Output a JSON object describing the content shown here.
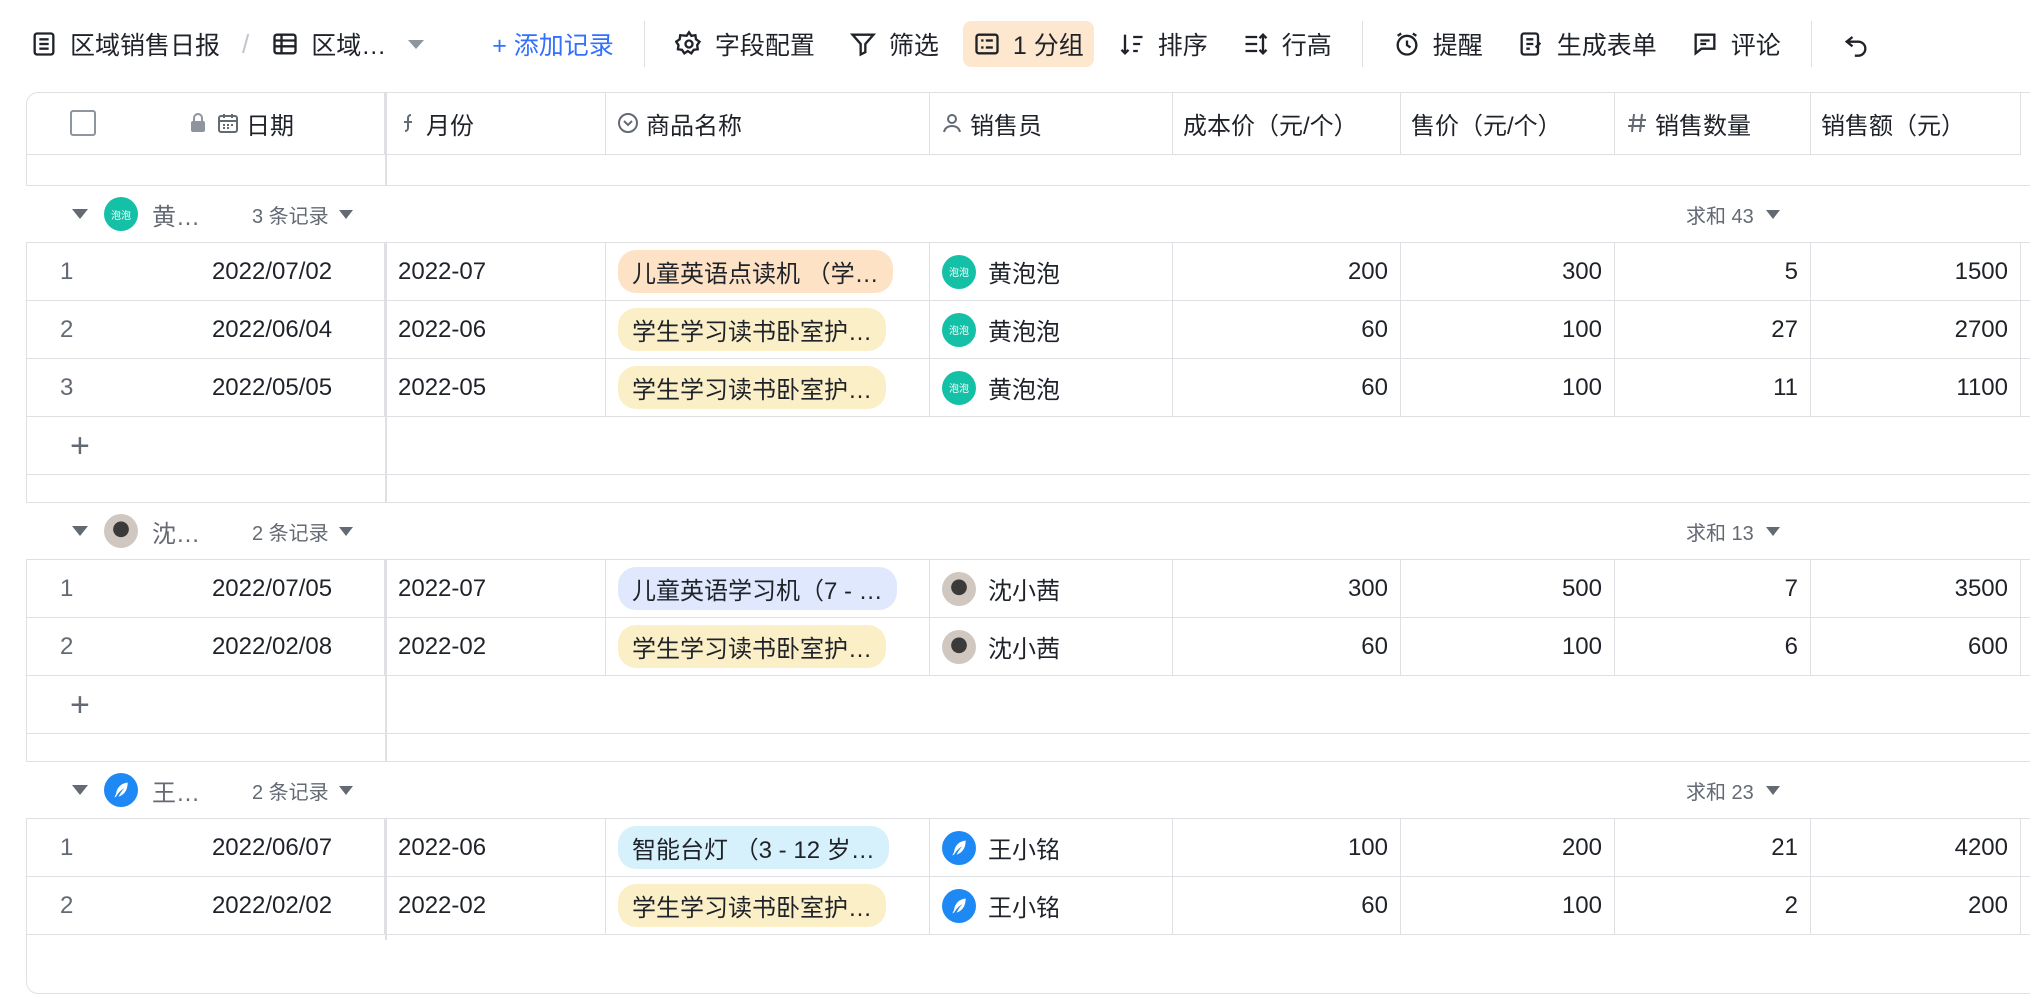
{
  "toolbar": {
    "table_name": "区域销售日报",
    "view_name": "区域…",
    "add_record": "+ 添加记录",
    "field_config": "字段配置",
    "filter": "筛选",
    "group": "1 分组",
    "sort": "排序",
    "row_height": "行高",
    "reminder": "提醒",
    "form": "生成表单",
    "comment": "评论"
  },
  "columns": {
    "date": "日期",
    "month": "月份",
    "product": "商品名称",
    "seller": "销售员",
    "cost": "成本价（元/个）",
    "price": "售价（元/个）",
    "qty": "销售数量",
    "revenue": "销售额（元）"
  },
  "colors": {
    "accent": "#3370ff",
    "group_active": "#fde7cf",
    "tag_orange": "#fde2c6",
    "tag_yellow": "#fbefc8",
    "tag_blue": "#dfe8fd",
    "tag_cyan": "#d6f1fb"
  },
  "groups": [
    {
      "name": "黄…",
      "count": "3 条记录",
      "sum": "求和 43",
      "avatar_text": "泡泡",
      "rows": [
        {
          "idx": "1",
          "date": "2022/07/02",
          "month": "2022-07",
          "product": "儿童英语点读机 （学…",
          "tag_color": "#fde2c6",
          "seller": "黄泡泡",
          "cost": "200",
          "price": "300",
          "qty": "5",
          "revenue": "1500"
        },
        {
          "idx": "2",
          "date": "2022/06/04",
          "month": "2022-06",
          "product": "学生学习读书卧室护…",
          "tag_color": "#fbefc8",
          "seller": "黄泡泡",
          "cost": "60",
          "price": "100",
          "qty": "27",
          "revenue": "2700"
        },
        {
          "idx": "3",
          "date": "2022/05/05",
          "month": "2022-05",
          "product": "学生学习读书卧室护…",
          "tag_color": "#fbefc8",
          "seller": "黄泡泡",
          "cost": "60",
          "price": "100",
          "qty": "11",
          "revenue": "1100"
        }
      ]
    },
    {
      "name": "沈…",
      "count": "2 条记录",
      "sum": "求和 13",
      "avatar_text": "",
      "rows": [
        {
          "idx": "1",
          "date": "2022/07/05",
          "month": "2022-07",
          "product": "儿童英语学习机（7 - …",
          "tag_color": "#dfe8fd",
          "seller": "沈小茜",
          "cost": "300",
          "price": "500",
          "qty": "7",
          "revenue": "3500"
        },
        {
          "idx": "2",
          "date": "2022/02/08",
          "month": "2022-02",
          "product": "学生学习读书卧室护…",
          "tag_color": "#fbefc8",
          "seller": "沈小茜",
          "cost": "60",
          "price": "100",
          "qty": "6",
          "revenue": "600"
        }
      ]
    },
    {
      "name": "王…",
      "count": "2 条记录",
      "sum": "求和 23",
      "avatar_text": "",
      "rows": [
        {
          "idx": "1",
          "date": "2022/06/07",
          "month": "2022-06",
          "product": "智能台灯 （3 - 12 岁…",
          "tag_color": "#d6f1fb",
          "seller": "王小铭",
          "cost": "100",
          "price": "200",
          "qty": "21",
          "revenue": "4200"
        },
        {
          "idx": "2",
          "date": "2022/02/02",
          "month": "2022-02",
          "product": "学生学习读书卧室护…",
          "tag_color": "#fbefc8",
          "seller": "王小铭",
          "cost": "60",
          "price": "100",
          "qty": "2",
          "revenue": "200"
        }
      ]
    }
  ]
}
